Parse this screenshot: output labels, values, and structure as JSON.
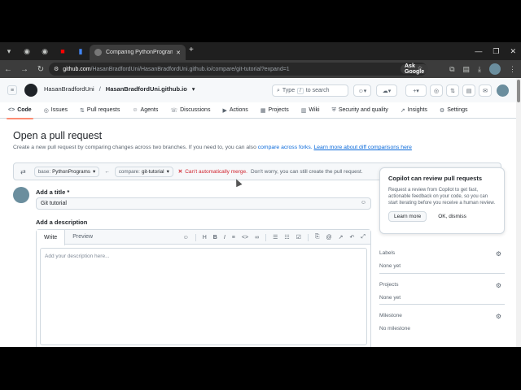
{
  "browser": {
    "tab_title": "Comparing PythonPrograms...",
    "url_host": "github.com",
    "url_path": "/HasanBradfordUni/HasanBradfordUni.github.io/compare/git-tutorial?expand=1",
    "ask_google": "Ask Google"
  },
  "header": {
    "owner": "HasanBradfordUni",
    "separator": "/",
    "repo": "HasanBradfordUni.github.io",
    "search_placeholder_pre": "Type",
    "search_key": "/",
    "search_placeholder_post": "to search"
  },
  "repo_nav": [
    {
      "label": "Code",
      "icon": "<>"
    },
    {
      "label": "Issues",
      "icon": "◎"
    },
    {
      "label": "Pull requests",
      "icon": "⇅"
    },
    {
      "label": "Agents",
      "icon": "☺"
    },
    {
      "label": "Discussions",
      "icon": "☏"
    },
    {
      "label": "Actions",
      "icon": "▶"
    },
    {
      "label": "Projects",
      "icon": "▦"
    },
    {
      "label": "Wiki",
      "icon": "▥"
    },
    {
      "label": "Security and quality",
      "icon": "⛨"
    },
    {
      "label": "Insights",
      "icon": "↗"
    },
    {
      "label": "Settings",
      "icon": "⚙"
    }
  ],
  "page": {
    "title": "Open a pull request",
    "subtitle_pre": "Create a new pull request by comparing changes across two branches. If you need to, you can also",
    "subtitle_link1": "compare across forks.",
    "subtitle_link2": "Learn more about diff comparisons here"
  },
  "compare": {
    "base_label": "base:",
    "base_value": "PythonPrograms",
    "compare_label": "compare:",
    "compare_value": "git-tutorial",
    "merge_status": "Can't automatically merge.",
    "merge_desc": "Don't worry, you can still create the pull request."
  },
  "form": {
    "title_label": "Add a title *",
    "title_value": "Git tutorial",
    "desc_label": "Add a description",
    "tab_write": "Write",
    "tab_preview": "Preview",
    "desc_placeholder": "Add your description here..."
  },
  "copilot": {
    "title": "Copilot can review pull requests",
    "desc": "Request a review from Copilot to get fast, actionable feedback on your code, so you can start iterating before you receive a human review.",
    "learn_more": "Learn more",
    "dismiss": "OK, dismiss"
  },
  "sidebar": {
    "labels_heading": "Labels",
    "labels_value": "None yet",
    "projects_heading": "Projects",
    "projects_value": "None yet",
    "milestone_heading": "Milestone",
    "milestone_value": "No milestone"
  }
}
